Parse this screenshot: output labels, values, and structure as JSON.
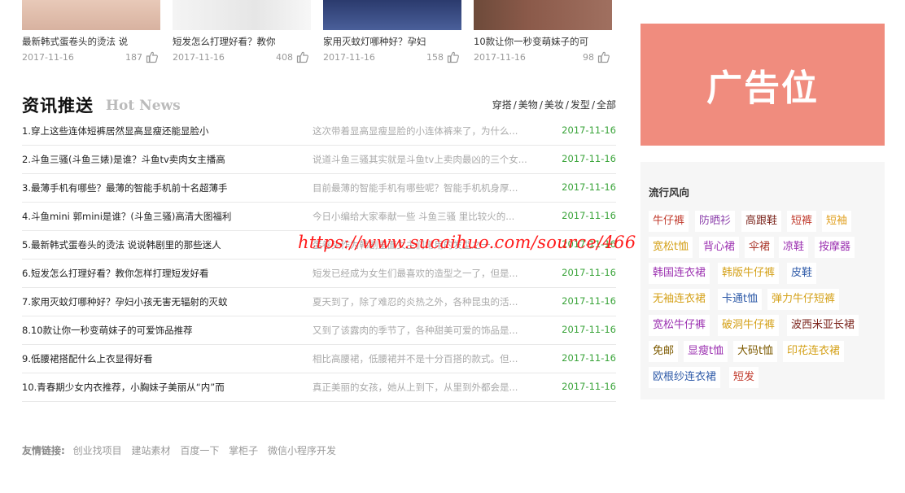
{
  "cards": [
    {
      "title": "最新韩式蛋卷头的烫法 说",
      "date": "2017-11-16",
      "count": "187"
    },
    {
      "title": "短发怎么打理好看？教你",
      "date": "2017-11-16",
      "count": "408"
    },
    {
      "title": "家用灭蚊灯哪种好？孕妇",
      "date": "2017-11-16",
      "count": "158"
    },
    {
      "title": "10款让你一秒变萌妹子的可",
      "date": "2017-11-16",
      "count": "98"
    }
  ],
  "section": {
    "title_cn": "资讯推送",
    "title_en": "Hot News",
    "categories": [
      "穿搭",
      "美物",
      "美妆",
      "发型",
      "全部"
    ]
  },
  "news": [
    {
      "title": "1.穿上这些连体短裤居然显高显瘦还能显脸小",
      "desc": "这次带着显高显瘦显脸的小连体裤来了，为什么...",
      "date": "2017-11-16"
    },
    {
      "title": "2.斗鱼三骚(斗鱼三婊)是谁？斗鱼tv卖肉女主播高",
      "desc": "说道斗鱼三骚其实就是斗鱼tv上卖肉最凶的三个女...",
      "date": "2017-11-16"
    },
    {
      "title": "3.最薄手机有哪些？最薄的智能手机前十名超薄手",
      "desc": "目前最薄的智能手机有哪些呢？智能手机机身厚...",
      "date": "2017-11-16"
    },
    {
      "title": "4.斗鱼mini 郭mini是谁？(斗鱼三骚)高清大图福利",
      "desc": "今日小编给大家奉献一些 斗鱼三骚 里比较火的...",
      "date": "2017-11-16"
    },
    {
      "title": "5.最新韩式蛋卷头的烫法 说说韩剧里的那些迷人",
      "desc": "蛋卷头作为韩剧里面女主们常用的发型之一...",
      "date": "2017-11-16"
    },
    {
      "title": "6.短发怎么打理好看？教你怎样打理短发好看",
      "desc": "短发已经成为女生们最喜欢的造型之一了，但是...",
      "date": "2017-11-16"
    },
    {
      "title": "7.家用灭蚊灯哪种好？孕妇小孩无害无辐射的灭蚊",
      "desc": "夏天到了，除了难忍的炎热之外，各种昆虫的活...",
      "date": "2017-11-16"
    },
    {
      "title": "8.10款让你一秒变萌妹子的可爱饰品推荐",
      "desc": "又到了该露肉的季节了，各种甜美可爱的饰品是...",
      "date": "2017-11-16"
    },
    {
      "title": "9.低腰裙搭配什么上衣显得好看",
      "desc": "相比高腰裙，低腰裙并不是十分百搭的款式。但...",
      "date": "2017-11-16"
    },
    {
      "title": "10.青春期少女内衣推荐，小胸妹子美丽从“内”而",
      "desc": "真正美丽的女孩，她从上到下，从里到外都会是...",
      "date": "2017-11-16"
    }
  ],
  "watermark": "https://www.sucaihuo.com/source/466",
  "friends": {
    "label": "友情链接:",
    "links": [
      "创业找项目",
      "建站素材",
      "百度一下",
      "掌柜子",
      "微信小程序开发"
    ]
  },
  "ad": {
    "text": "广告位",
    "color": "#f08c7e"
  },
  "trend": {
    "title": "流行风向",
    "rows": [
      [
        {
          "label": "牛仔裤",
          "color": "#c0392b"
        },
        {
          "label": "防晒衫",
          "color": "#8e44ad"
        },
        {
          "label": "高跟鞋",
          "color": "#7b241c"
        },
        {
          "label": "短裤",
          "color": "#c0392b"
        },
        {
          "label": "短袖",
          "color": "#e0a020"
        }
      ],
      [
        {
          "label": "宽松t恤",
          "color": "#d4a017"
        },
        {
          "label": "背心裙",
          "color": "#9b30b0"
        },
        {
          "label": "伞裙",
          "color": "#a93226"
        },
        {
          "label": "凉鞋",
          "color": "#9b30b0"
        },
        {
          "label": "按摩器",
          "color": "#9b30b0"
        }
      ],
      [
        {
          "label": "韩国连衣裙",
          "color": "#9b30b0"
        },
        {
          "label": "韩版牛仔裤",
          "color": "#d4a017"
        },
        {
          "label": "皮鞋",
          "color": "#2e5aa8"
        }
      ],
      [
        {
          "label": "无袖连衣裙",
          "color": "#d4a017"
        },
        {
          "label": "卡通t恤",
          "color": "#2e5aa8"
        },
        {
          "label": "弹力牛仔短裤",
          "color": "#d4a017"
        }
      ],
      [
        {
          "label": "宽松牛仔裤",
          "color": "#9b30b0"
        },
        {
          "label": "破洞牛仔裤",
          "color": "#d4a017"
        },
        {
          "label": "波西米亚长裙",
          "color": "#7b241c"
        }
      ],
      [
        {
          "label": "免邮",
          "color": "#7d5a00"
        },
        {
          "label": "显瘦t恤",
          "color": "#9b30b0"
        },
        {
          "label": "大码t恤",
          "color": "#7d5a00"
        },
        {
          "label": "印花连衣裙",
          "color": "#d4a017"
        }
      ],
      [
        {
          "label": "欧根纱连衣裙",
          "color": "#2e5aa8"
        },
        {
          "label": "短发",
          "color": "#c0392b"
        }
      ]
    ]
  }
}
